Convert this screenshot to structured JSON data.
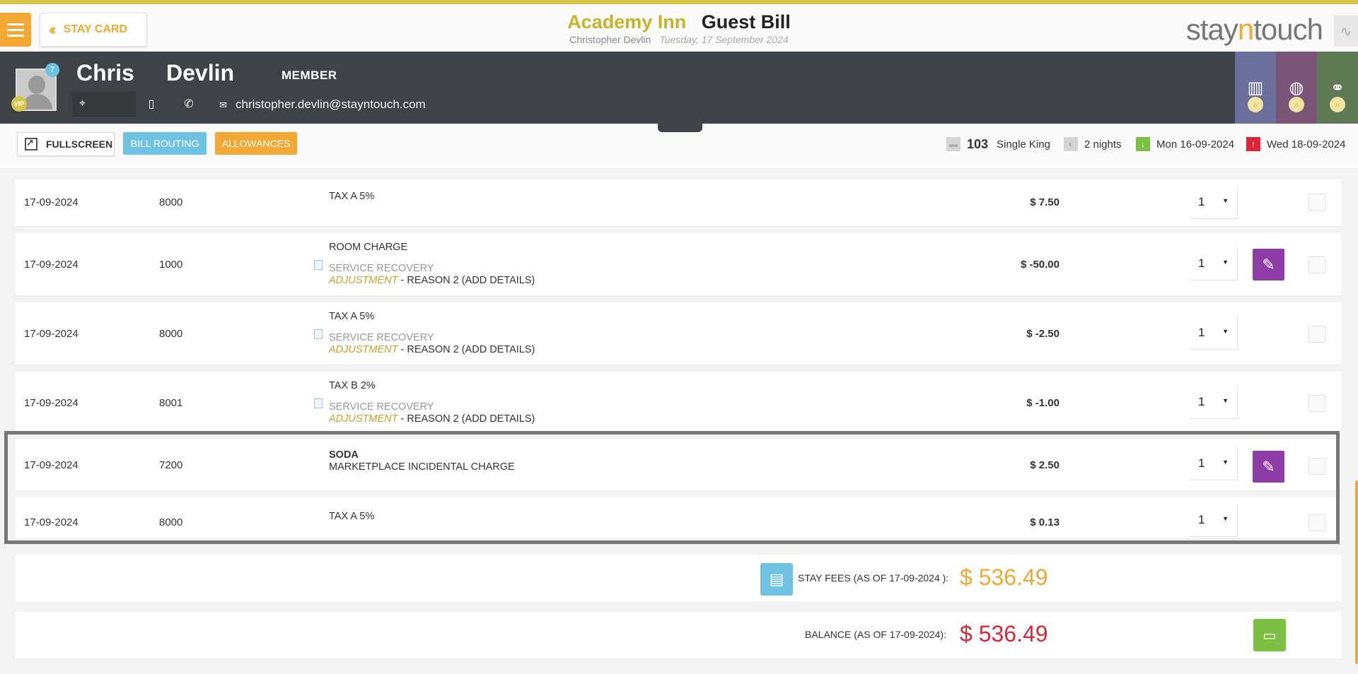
{
  "header": {
    "stay_card_label": "STAY CARD",
    "hotel_name": "Academy Inn",
    "page_title": "Guest Bill",
    "guest_fullname": "Christopher Devlin",
    "date": "Tuesday, 17 September 2024",
    "brand_left": "stay",
    "brand_mid": "n",
    "brand_right": "touch"
  },
  "guest": {
    "first_name": "Chris",
    "last_name": "Devlin",
    "membership": "MEMBER",
    "vip": "VIP",
    "notification_count": "7",
    "email": "christopher.devlin@stayntouch.com"
  },
  "toolbar": {
    "fullscreen_label": "FULLSCREEN",
    "bill_routing_label": "BILL ROUTING",
    "allowances_label": "ALLOWANCES",
    "room_number": "103",
    "room_type": "Single King",
    "nights": "2 nights",
    "arrival": "Mon 16-09-2024",
    "departure": "Wed 18-09-2024"
  },
  "rows": [
    {
      "date": "17-09-2024",
      "code": "8000",
      "desc": "TAX A 5%",
      "amount": "$ 7.50",
      "qty": "1"
    },
    {
      "date": "17-09-2024",
      "code": "1000",
      "desc": "ROOM CHARGE",
      "sub1": "SERVICE RECOVERY",
      "adj": "ADJUSTMENT",
      "reason": " - REASON 2 (ADD DETAILS)",
      "amount": "$ -50.00",
      "qty": "1"
    },
    {
      "date": "17-09-2024",
      "code": "8000",
      "desc": "TAX A 5%",
      "sub1": "SERVICE RECOVERY",
      "adj": "ADJUSTMENT",
      "reason": " - REASON 2 (ADD DETAILS)",
      "amount": "$ -2.50",
      "qty": "1"
    },
    {
      "date": "17-09-2024",
      "code": "8001",
      "desc": "TAX B 2%",
      "sub1": "SERVICE RECOVERY",
      "adj": "ADJUSTMENT",
      "reason": " - REASON 2 (ADD DETAILS)",
      "amount": "$ -1.00",
      "qty": "1"
    },
    {
      "date": "17-09-2024",
      "code": "7200",
      "desc": "SODA",
      "sub1": "MARKETPLACE INCIDENTAL CHARGE",
      "amount": "$ 2.50",
      "qty": "1"
    },
    {
      "date": "17-09-2024",
      "code": "8000",
      "desc": "TAX A 5%",
      "amount": "$ 0.13",
      "qty": "1"
    }
  ],
  "totals": {
    "stay_fees_label": "STAY FEES (AS OF  17-09-2024 ):",
    "stay_fees_value": "$ 536.49",
    "balance_label": "BALANCE (AS OF  17-09-2024):",
    "balance_value": "$ 536.49"
  },
  "colors": {
    "accent": "#f2a833",
    "gold": "#c9b22a",
    "balance_red": "#d82837",
    "edit_purple": "#8e3da6"
  }
}
